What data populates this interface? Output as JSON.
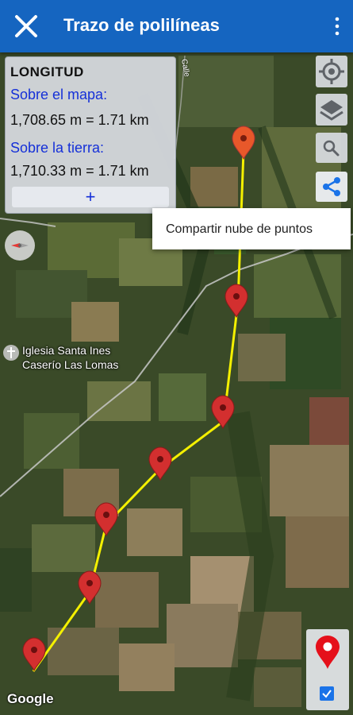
{
  "appbar": {
    "title": "Trazo de polilíneas"
  },
  "info_panel": {
    "title": "LONGITUD",
    "map_label": "Sobre el mapa:",
    "map_value": "1,708.65 m = 1.71 km",
    "ground_label": "Sobre la tierra:",
    "ground_value": "1,710.33 m = 1.71 km",
    "add_label": "+"
  },
  "share_menu": {
    "item": "Compartir nube de puntos"
  },
  "map": {
    "poi_line1": "Iglesia Santa Ines",
    "poi_line2": "Caserío Las Lomas",
    "road_label": "Calle",
    "attribution": "Google",
    "polyline_color": "#f4f000",
    "marker_color": "#d32f2f"
  },
  "colors": {
    "appbar": "#1565c0",
    "accent_blue": "#1a73e8"
  },
  "icons": {
    "close": "close-icon",
    "menu": "more-vert-icon",
    "location": "my-location-icon",
    "layers": "layers-icon",
    "search": "search-icon",
    "share": "share-icon",
    "compass": "compass-icon",
    "place": "place-pin-icon",
    "check": "checkbox-icon"
  }
}
